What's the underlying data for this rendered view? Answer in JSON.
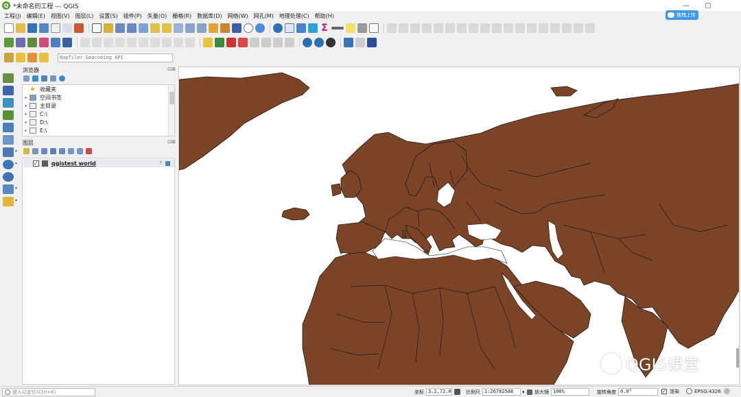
{
  "window": {
    "title": "*未命名的工程 — QGIS",
    "logo_letter": "Q",
    "controls": {
      "minimize": "—",
      "restore": "▢"
    }
  },
  "menubar": {
    "items": [
      "工程(J)",
      "编辑(E)",
      "视图(V)",
      "图层(L)",
      "设置(S)",
      "插件(P)",
      "矢量(O)",
      "栅格(R)",
      "数据库(D)",
      "网络(W)",
      "网孔(M)",
      "地理处理(C)",
      "帮助(H)"
    ]
  },
  "cloud_button": {
    "label": "拖拽上传"
  },
  "geocoder": {
    "placeholder": "NapTiler Geocoding API"
  },
  "browser_panel": {
    "title": "浏览器",
    "close": "⊡⊠",
    "items": [
      {
        "label": "收藏夹",
        "icon": "star-icon"
      },
      {
        "label": "空间书签",
        "icon": "bookmark-icon"
      },
      {
        "label": "主目录",
        "icon": "home-folder-icon"
      },
      {
        "label": "C:\\",
        "icon": "folder-icon"
      },
      {
        "label": "D:\\",
        "icon": "folder-icon"
      },
      {
        "label": "E:\\",
        "icon": "folder-icon"
      }
    ]
  },
  "layers_panel": {
    "title": "图层",
    "close": "⊡⊠",
    "layer": {
      "name": "qgistest world",
      "checked": "✓",
      "color": "#7b4427"
    }
  },
  "map": {
    "land_color": "#7b4427",
    "border_color": "#1a1a1a",
    "background": "#ffffff"
  },
  "watermark": {
    "text": "QGIS课堂"
  },
  "statusbar": {
    "search_placeholder": "键入以定位(Ctrl+K)",
    "coordinate_label": "坐标",
    "coordinate": "3.2,72.0",
    "scale_label": "比例尺",
    "scale": "1:26782588",
    "magnifier_label": "放大镜",
    "magnifier": "100%",
    "rotation_label": "旋转角度",
    "rotation": "0.0°",
    "render_label": "渲染",
    "render_checked": "✓",
    "crs": "EPSG:4326"
  }
}
